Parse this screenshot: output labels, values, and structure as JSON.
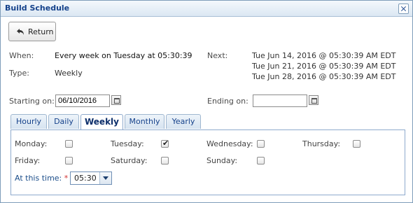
{
  "window": {
    "title": "Build Schedule"
  },
  "toolbar": {
    "return_label": "Return"
  },
  "summary": {
    "when_label": "When:",
    "when_value": "Every week on Tuesday at 05:30:39",
    "type_label": "Type:",
    "type_value": "Weekly",
    "next_label": "Next:",
    "next_runs": [
      "Tue Jun 14, 2016 @ 05:30:39 AM EDT",
      "Tue Jun 21, 2016 @ 05:30:39 AM EDT",
      "Tue Jun 28, 2016 @ 05:30:39 AM EDT"
    ]
  },
  "range": {
    "starting_label": "Starting on:",
    "starting_value": "06/10/2016",
    "ending_label": "Ending on:",
    "ending_value": ""
  },
  "tabs": [
    {
      "label": "Hourly",
      "active": false
    },
    {
      "label": "Daily",
      "active": false
    },
    {
      "label": "Weekly",
      "active": true
    },
    {
      "label": "Monthly",
      "active": false
    },
    {
      "label": "Yearly",
      "active": false
    }
  ],
  "weekly": {
    "days": [
      {
        "label": "Monday:",
        "checked": false
      },
      {
        "label": "Tuesday:",
        "checked": true
      },
      {
        "label": "Wednesday:",
        "checked": false
      },
      {
        "label": "Thursday:",
        "checked": false
      },
      {
        "label": "Friday:",
        "checked": false
      },
      {
        "label": "Saturday:",
        "checked": false
      },
      {
        "label": "Sunday:",
        "checked": false
      }
    ],
    "time_label": "At this time:",
    "time_required_mark": "*",
    "time_value": "05:30"
  }
}
